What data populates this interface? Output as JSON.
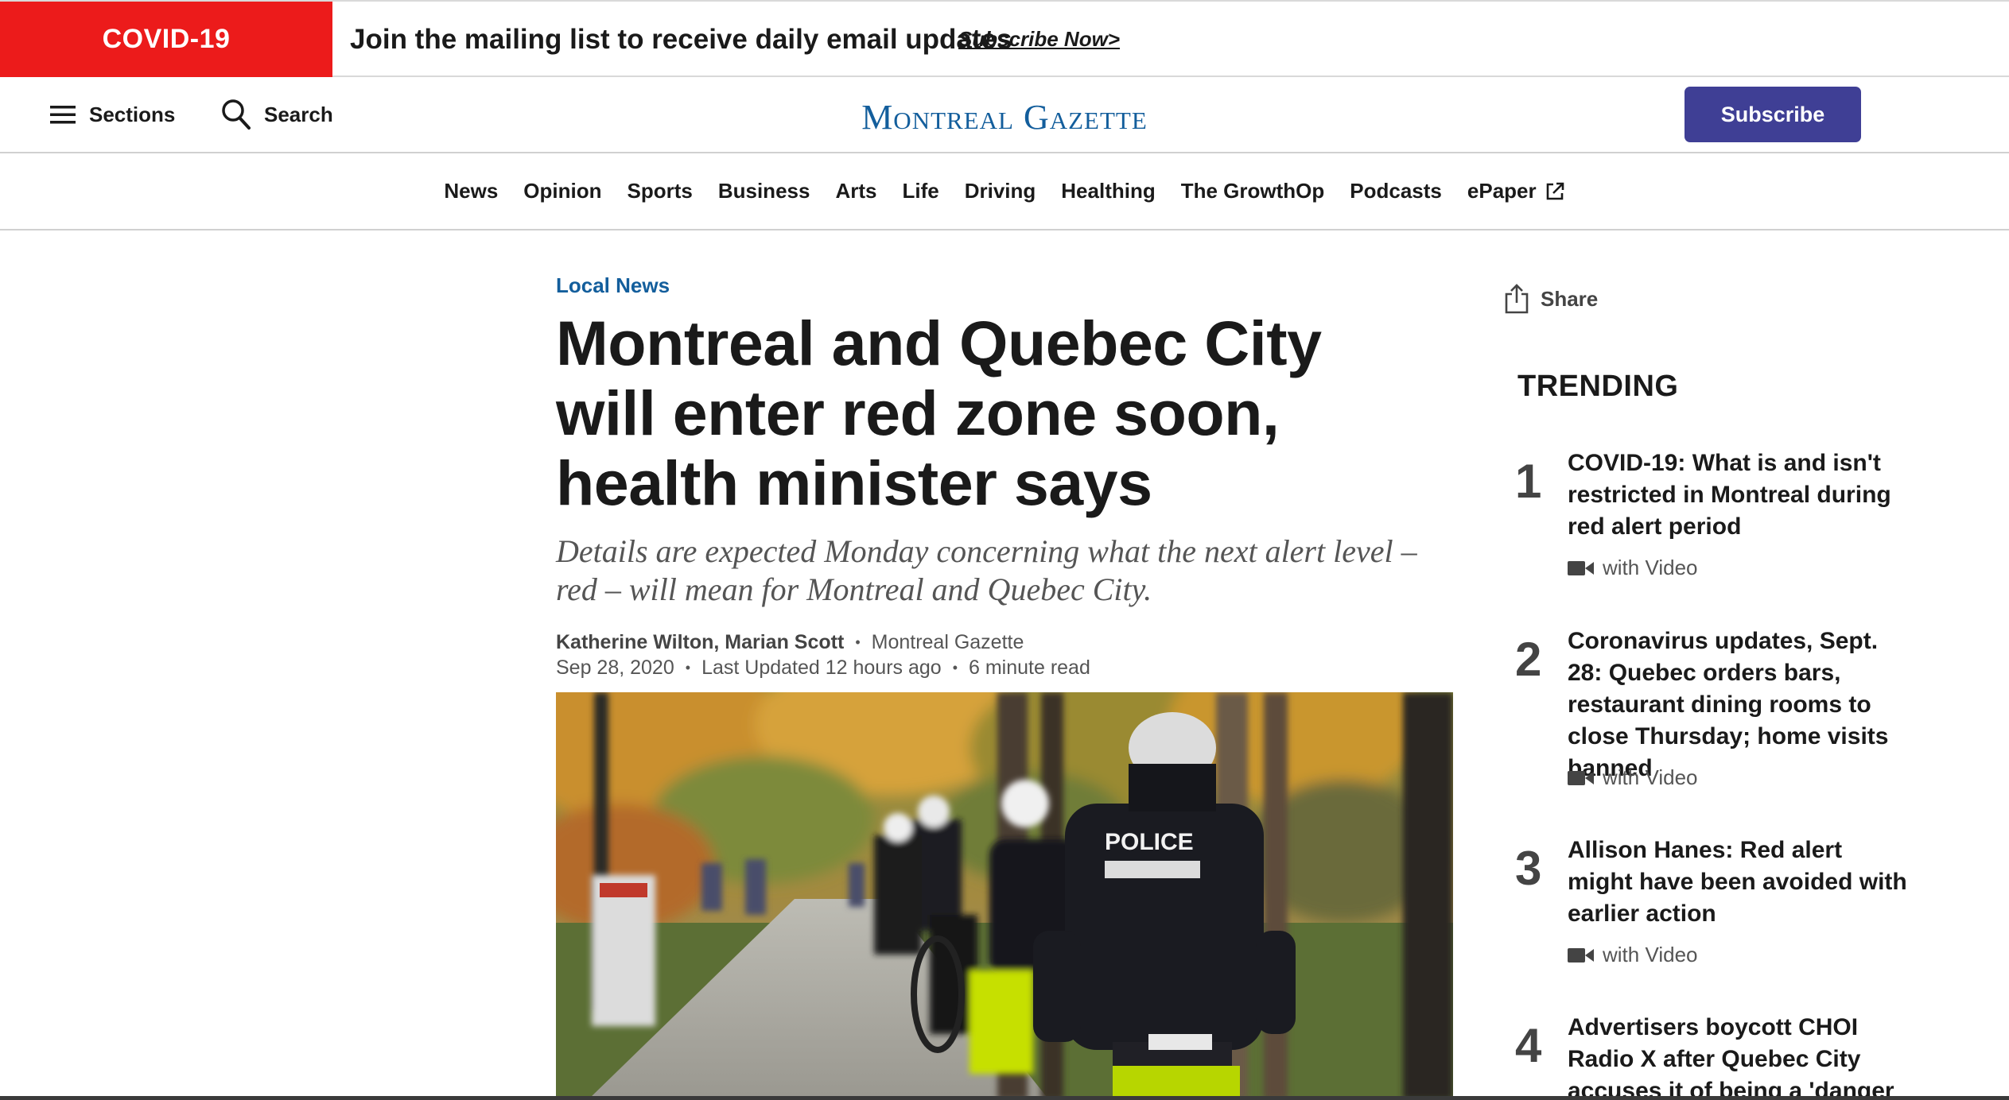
{
  "promo": {
    "badge": "COVID-19",
    "message": "Join the mailing list to receive daily email updates",
    "cta": "Subscribe Now>"
  },
  "header": {
    "sections_label": "Sections",
    "search_label": "Search",
    "logo": "Montreal Gazette",
    "subscribe_label": "Subscribe"
  },
  "nav": {
    "items": [
      "News",
      "Opinion",
      "Sports",
      "Business",
      "Arts",
      "Life",
      "Driving",
      "Healthing",
      "The GrowthOp",
      "Podcasts",
      "ePaper"
    ]
  },
  "article": {
    "kicker": "Local News",
    "headline": "Montreal and Quebec City will enter red zone soon, health minister says",
    "dek": "Details are expected Monday concerning what the next alert level – red – will mean for Montreal and Quebec City.",
    "authors": "Katherine Wilton, Marian Scott",
    "publication": "Montreal Gazette",
    "date": "Sep 28, 2020",
    "updated": "Last Updated 12 hours ago",
    "read_time": "6 minute read",
    "photo_vest_text": "POLICE"
  },
  "sidebar": {
    "share_label": "Share",
    "trending_title": "TRENDING",
    "trending": [
      {
        "num": "1",
        "title": "COVID-19: What is and isn't restricted in Montreal during red alert period",
        "video": "with Video"
      },
      {
        "num": "2",
        "title": "Coronavirus updates, Sept. 28: Quebec orders bars, restaurant dining rooms to close Thursday; home visits banned",
        "video": "with Video"
      },
      {
        "num": "3",
        "title": "Allison Hanes: Red alert might have been avoided with earlier action",
        "video": "with Video"
      },
      {
        "num": "4",
        "title": "Advertisers boycott CHOI Radio X after Quebec City accuses it of being a 'danger to public"
      }
    ]
  },
  "colors": {
    "covid_red": "#ec1b1b",
    "brand_blue": "#135e9c",
    "subscribe_purple": "#3f3f95"
  },
  "icons": [
    "hamburger-icon",
    "search-icon",
    "external-link-icon",
    "share-icon",
    "video-camera-icon"
  ]
}
